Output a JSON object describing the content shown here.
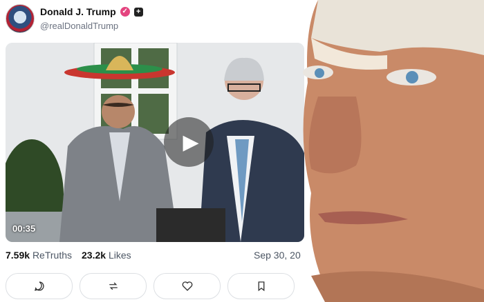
{
  "header": {
    "display_name": "Donald J. Trump",
    "handle": "@realDonaldTrump"
  },
  "video": {
    "duration": "00:35"
  },
  "stats": {
    "retruths_value": "7.59k",
    "retruths_label": "ReTruths",
    "likes_value": "23.2k",
    "likes_label": "Likes",
    "date": "Sep 30, 20"
  },
  "actions": [
    "reply-icon",
    "retruth-icon",
    "like-icon",
    "bookmark-icon"
  ]
}
